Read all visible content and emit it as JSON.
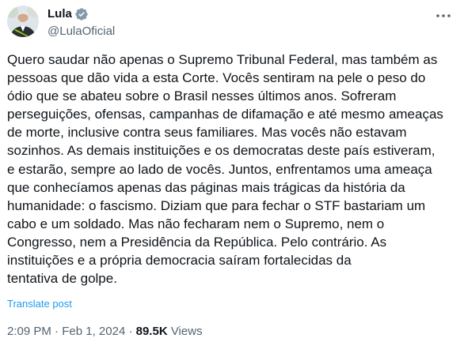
{
  "author": {
    "display_name": "Lula",
    "handle": "@LulaOficial",
    "verified_color": "#829aab"
  },
  "tweet": {
    "text": "Quero saudar não apenas o Supremo Tribunal Federal, mas também as\npessoas que dão vida a esta Corte. Vocês sentiram na pele o peso do\nódio que se abateu sobre o Brasil nesses últimos anos. Sofreram\nperseguições, ofensas, campanhas de difamação e até mesmo ameaças\nde morte, inclusive contra seus familiares. Mas vocês não estavam\nsozinhos. As demais instituições e os democratas deste país estiveram,\ne estarão, sempre ao lado de vocês. Juntos, enfrentamos uma ameaça\nque conhecíamos apenas das páginas mais trágicas da história da\nhumanidade: o fascismo. Diziam que para fechar o STF bastariam um\ncabo e um soldado. Mas não fecharam nem o Supremo, nem o\nCongresso, nem a Presidência da República. Pelo contrário. As\ninstituições e a própria democracia saíram fortalecidas da\ntentativa de golpe.",
    "translate_label": "Translate post",
    "time": "2:09 PM",
    "separator": "·",
    "date": "Feb 1, 2024",
    "views_count": "89.5K",
    "views_label": "Views"
  },
  "colors": {
    "text": "#0f1419",
    "secondary": "#536471",
    "link": "#1d9bf0"
  },
  "icons": {
    "avatar": "profile-photo",
    "verified": "verified-badge-icon",
    "more": "more-options-icon"
  }
}
